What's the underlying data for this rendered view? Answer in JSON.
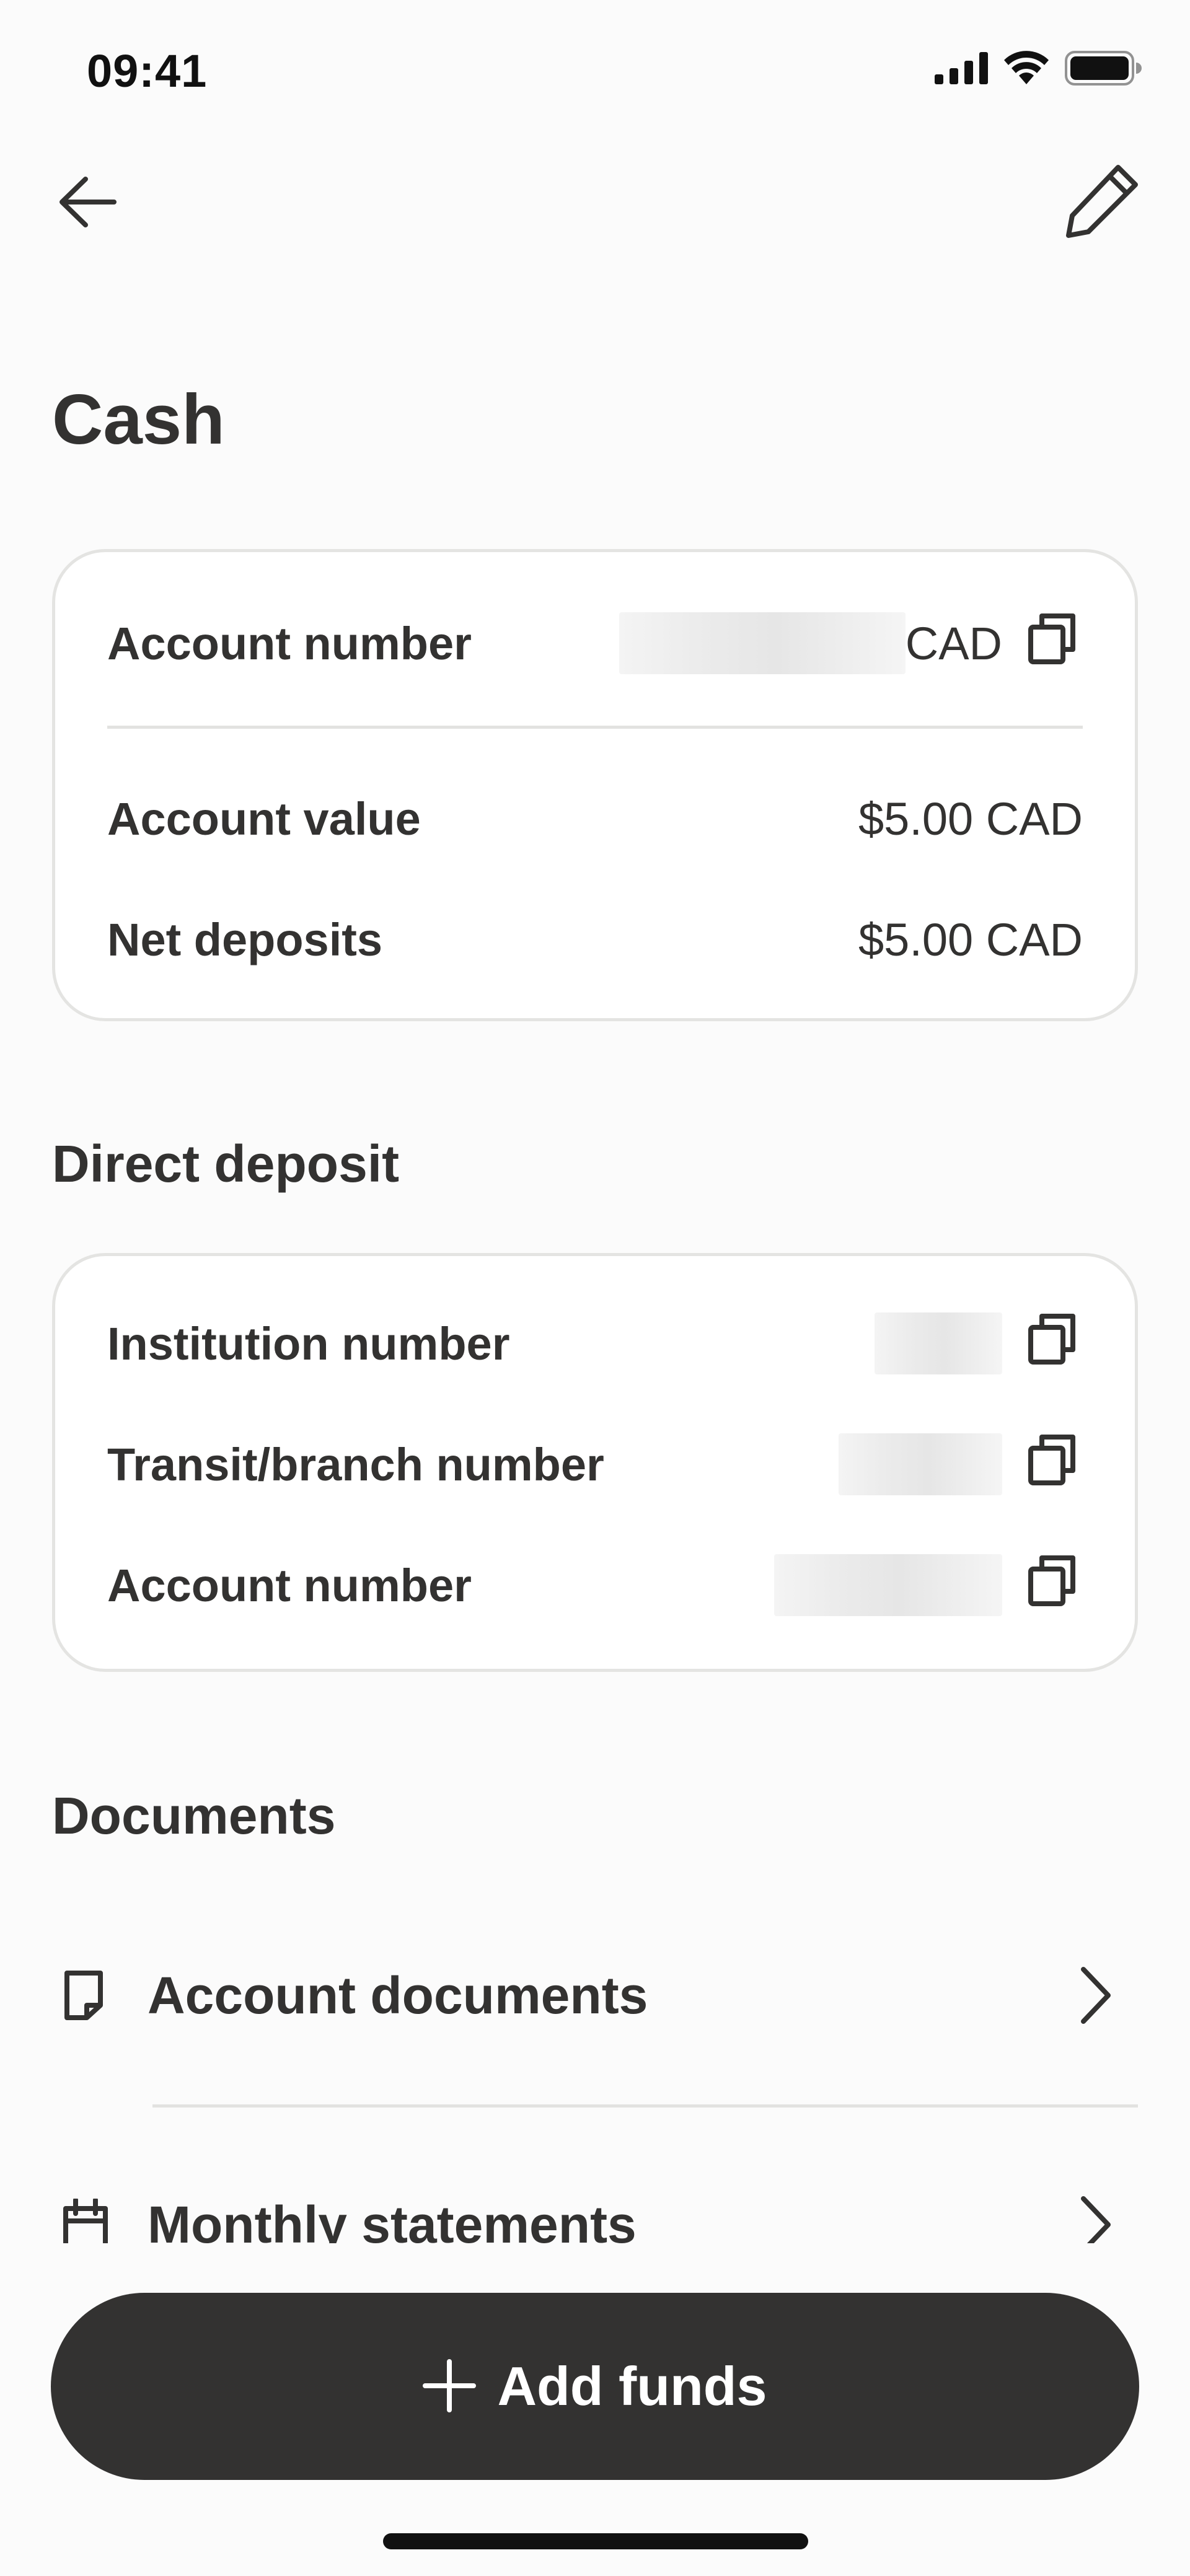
{
  "status_bar": {
    "time": "09:41",
    "icons": [
      "cellular-signal-icon",
      "wifi-icon",
      "battery-icon"
    ]
  },
  "nav": {
    "back_icon": "arrow-left-icon",
    "edit_icon": "pencil-icon"
  },
  "page": {
    "title": "Cash"
  },
  "account_card": {
    "account_number_label": "Account number",
    "account_number_value": "[redacted]",
    "account_number_suffix": "CAD",
    "account_value_label": "Account value",
    "account_value": "$5.00 CAD",
    "net_deposits_label": "Net deposits",
    "net_deposits_value": "$5.00 CAD"
  },
  "direct_deposit": {
    "title": "Direct deposit",
    "institution_label": "Institution number",
    "institution_value": "[redacted]",
    "transit_label": "Transit/branch number",
    "transit_value": "[redacted]",
    "account_label": "Account number",
    "account_value": "[redacted]"
  },
  "documents": {
    "title": "Documents",
    "items": [
      {
        "label": "Account documents",
        "icon": "document-icon"
      },
      {
        "label": "Monthly statements",
        "icon": "calendar-icon"
      }
    ]
  },
  "actions": {
    "add_funds_label": "Add funds",
    "add_funds_icon": "plus-icon"
  },
  "colors": {
    "background": "#fbfbfb",
    "card": "#ffffff",
    "border": "#e4e4e2",
    "text": "#333231",
    "button": "#333231"
  }
}
